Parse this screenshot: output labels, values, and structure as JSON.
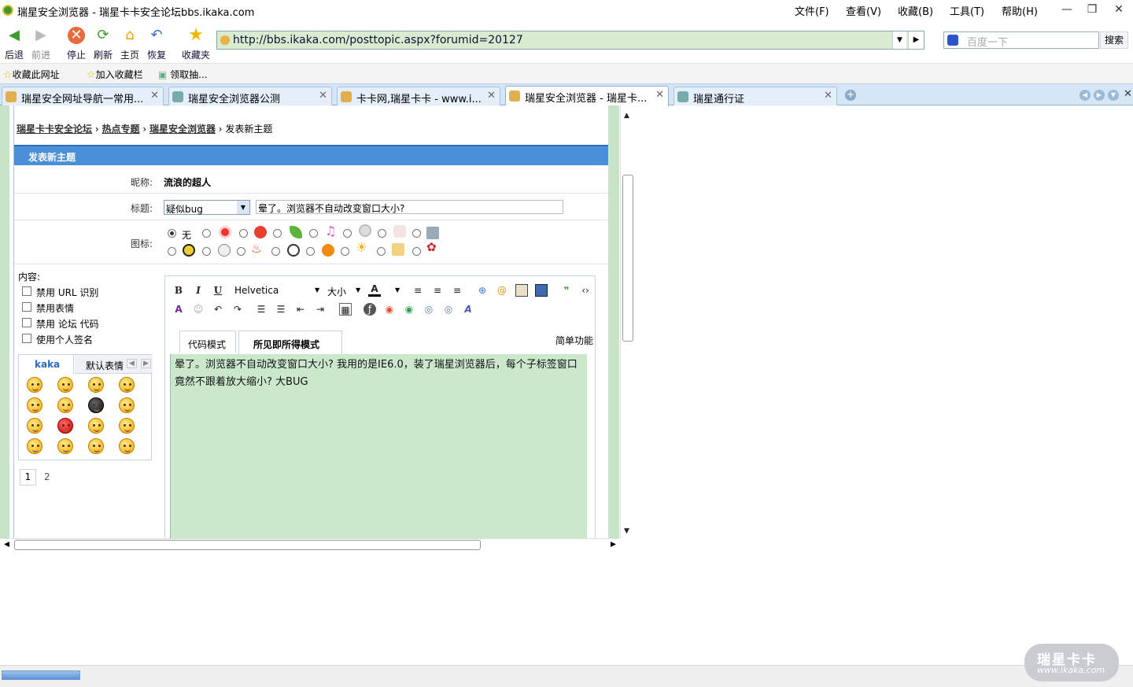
{
  "window": {
    "title": "瑞星安全浏览器 - 瑞星卡卡安全论坛bbs.ikaka.com",
    "menu": [
      "文件(F)",
      "查看(V)",
      "收藏(B)",
      "工具(T)",
      "帮助(H)"
    ],
    "controls": {
      "minimize": "—",
      "maximize": "❐",
      "close": "✕"
    }
  },
  "toolbar": {
    "back": "后退",
    "forward": "前进",
    "stop": "停止",
    "refresh": "刷新",
    "home": "主页",
    "restore": "恢复",
    "favorites": "收藏夹"
  },
  "address": {
    "url": "http://bbs.ikaka.com/posttopic.aspx?forumid=20127"
  },
  "search": {
    "placeholder": "百度一下",
    "button": "搜索"
  },
  "favbar": {
    "items": [
      "收藏此网址",
      "加入收藏栏",
      "领取抽..."
    ]
  },
  "tabs": [
    {
      "label": "瑞星安全网址导航一常用...",
      "active": false
    },
    {
      "label": "瑞星安全浏览器公测",
      "active": false
    },
    {
      "label": "卡卡网,瑞星卡卡 - www.i...",
      "active": false
    },
    {
      "label": "瑞星安全浏览器 - 瑞星卡...",
      "active": true
    },
    {
      "label": "瑞星通行证",
      "active": false
    }
  ],
  "page": {
    "breadcrumb": [
      "瑞星卡卡安全论坛",
      "热点专题",
      "瑞星安全浏览器",
      "发表新主题"
    ],
    "panel_title": "发表新主题",
    "nickname_label": "昵称:",
    "nickname": "流浪的超人",
    "subject_label": "标题:",
    "subject_type": "疑似bug",
    "subject": "晕了。浏览器不自动改变窗口大小?",
    "icon_label": "图标:",
    "icon_none": "无",
    "content_label": "内容:",
    "options": [
      "禁用 URL 识别",
      "禁用表情",
      "禁用 论坛 代码",
      "使用个人签名"
    ],
    "emoticon_tabs": [
      "kaka",
      "默认表情"
    ],
    "emoticon_pages": [
      "1",
      "2"
    ],
    "editor": {
      "font": "Helvetica",
      "size": "大小",
      "mode_tabs": [
        "代码模式",
        "所见即所得模式"
      ],
      "simple": "简单功能",
      "text": "晕了。浏览器不自动改变窗口大小? 我用的是IE6.0，装了瑞星浏览器后，每个子标签窗口竟然不跟着放大缩小? 大BUG"
    }
  },
  "brand": {
    "name": "瑞星卡卡",
    "url": "www.ikaka.com"
  }
}
